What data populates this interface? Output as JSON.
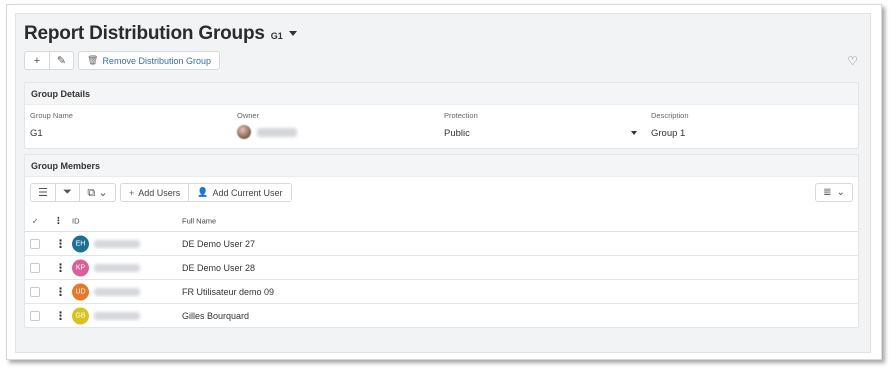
{
  "header": {
    "title": "Report Distribution Groups",
    "subtitle": "G1"
  },
  "toolbar": {
    "add_icon": "plus-icon",
    "edit_icon": "pencil-icon",
    "remove_label": "Remove Distribution Group",
    "remove_icon": "trash-icon",
    "favorite_icon": "heart-icon"
  },
  "details": {
    "title": "Group Details",
    "group_name_label": "Group Name",
    "group_name_value": "G1",
    "owner_label": "Owner",
    "protection_label": "Protection",
    "protection_value": "Public",
    "description_label": "Description",
    "description_value": "Group 1"
  },
  "members": {
    "title": "Group Members",
    "add_users_label": "Add Users",
    "add_current_user_label": "Add Current User",
    "columns": {
      "check": "✓",
      "menu": "⋮",
      "id": "ID",
      "full_name": "Full Name"
    },
    "rows": [
      {
        "initials": "EH",
        "color": "#1e6f96",
        "full_name": "DE Demo User 27"
      },
      {
        "initials": "KP",
        "color": "#d9609a",
        "full_name": "DE Demo User 28"
      },
      {
        "initials": "UD",
        "color": "#e8772a",
        "full_name": "FR Utilisateur demo 09"
      },
      {
        "initials": "GB",
        "color": "#d8c21c",
        "full_name": "Gilles Bourquard"
      }
    ]
  },
  "colors": {
    "link": "#3a6ea5",
    "panel_background": "#f2f3f5"
  }
}
